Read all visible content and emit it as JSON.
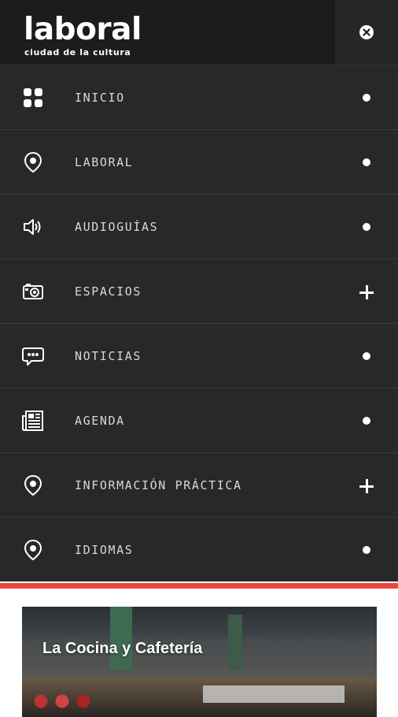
{
  "header": {
    "logo_main": "laboral",
    "logo_sub": "ciudad de la cultura"
  },
  "menu": {
    "items": [
      {
        "label": "INICIO",
        "icon": "grid-icon",
        "indicator": "dot"
      },
      {
        "label": "LABORAL",
        "icon": "location-pin-icon",
        "indicator": "dot"
      },
      {
        "label": "AUDIOGUÍAS",
        "icon": "speaker-icon",
        "indicator": "dot"
      },
      {
        "label": "ESPACIOS",
        "icon": "camera-icon",
        "indicator": "plus"
      },
      {
        "label": "NOTICIAS",
        "icon": "chat-bubble-icon",
        "indicator": "dot"
      },
      {
        "label": "AGENDA",
        "icon": "newspaper-icon",
        "indicator": "dot"
      },
      {
        "label": "INFORMACIÓN PRÁCTICA",
        "icon": "location-pin-icon",
        "indicator": "plus"
      },
      {
        "label": "IDIOMAS",
        "icon": "location-pin-icon",
        "indicator": "dot"
      }
    ]
  },
  "card": {
    "title": "La Cocina y Cafetería"
  },
  "colors": {
    "header_bg": "#1c1c1c",
    "menu_bg": "#282828",
    "accent_red": "#e8473a",
    "text": "#d8d8d8"
  }
}
